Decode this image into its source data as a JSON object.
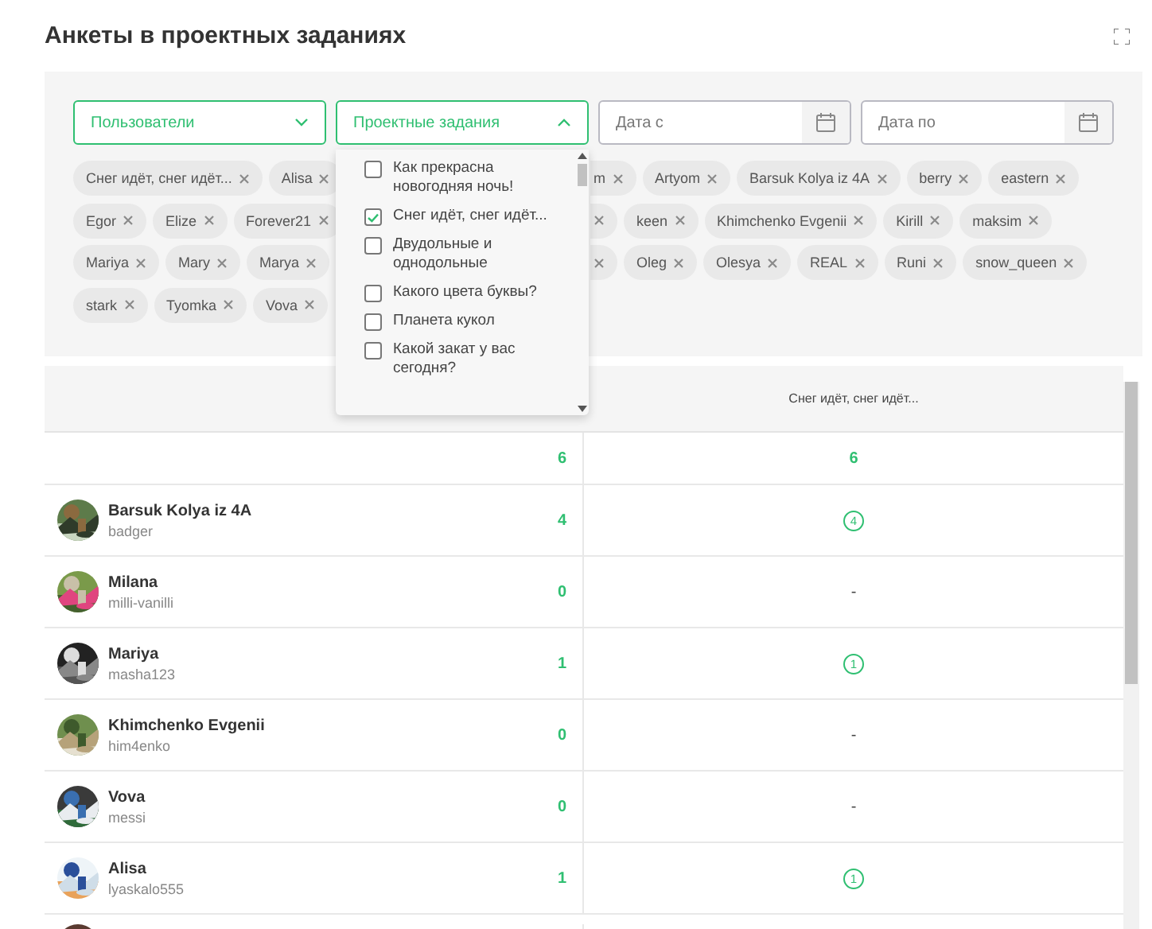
{
  "header": {
    "title": "Анкеты в проектных заданиях"
  },
  "filters": [
    {
      "kind": "select",
      "label": "Пользователи",
      "expanded": false
    },
    {
      "kind": "select",
      "label": "Проектные задания",
      "expanded": true
    },
    {
      "kind": "date",
      "placeholder": "Дата с"
    },
    {
      "kind": "date",
      "placeholder": "Дата по"
    }
  ],
  "tag_rows": [
    {
      "left": [
        {
          "label": "Снег идёт, снег идёт...",
          "clipped": false
        },
        {
          "label": "Alisa",
          "clipped": false
        }
      ],
      "right": [
        {
          "label": "m",
          "clipped": true
        },
        {
          "label": "Artyom",
          "clipped": false
        },
        {
          "label": "Barsuk Kolya iz 4A",
          "clipped": false
        },
        {
          "label": "berry",
          "clipped": false
        },
        {
          "label": "eastern",
          "clipped": false
        }
      ]
    },
    {
      "left": [
        {
          "label": "Egor",
          "clipped": false
        },
        {
          "label": "Elize",
          "clipped": false
        },
        {
          "label": "Forever21",
          "clipped": false
        }
      ],
      "right": [
        {
          "clipped": true
        },
        {
          "label": "keen",
          "clipped": false
        },
        {
          "label": "Khimchenko Evgenii",
          "clipped": false
        },
        {
          "label": "Kirill",
          "clipped": false
        },
        {
          "label": "maksim",
          "clipped": false
        }
      ]
    },
    {
      "left": [
        {
          "label": "Mariya",
          "clipped": false
        },
        {
          "label": "Mary",
          "clipped": false
        },
        {
          "label": "Marya",
          "clipped": false
        }
      ],
      "right": [
        {
          "clipped": true
        },
        {
          "label": "Oleg",
          "clipped": false
        },
        {
          "label": "Olesya",
          "clipped": false
        },
        {
          "label": "REAL",
          "clipped": false
        },
        {
          "label": "Runi",
          "clipped": false
        },
        {
          "label": "snow_queen",
          "clipped": false
        }
      ]
    },
    {
      "left": [
        {
          "label": "stark",
          "clipped": false
        },
        {
          "label": "Tyomka",
          "clipped": false
        },
        {
          "label": "Vova",
          "clipped": false
        }
      ],
      "right": []
    }
  ],
  "task_dropdown": {
    "items": [
      {
        "label": "Как прекрасна новогодняя ночь!",
        "checked": false
      },
      {
        "label": "Снег идёт, снег идёт...",
        "checked": true
      },
      {
        "label": "Двудольные и однодольные",
        "checked": false
      },
      {
        "label": "Какого цвета буквы?",
        "checked": false
      },
      {
        "label": "Планета кукол",
        "checked": false
      },
      {
        "label": "Какой закат у вас сегодня?",
        "checked": false
      }
    ]
  },
  "table": {
    "columns": [
      {
        "label": "Снег идёт, снег идёт..."
      }
    ],
    "total": {
      "count": "6",
      "values": [
        "6"
      ]
    },
    "rows": [
      {
        "kind": "user",
        "name": "Barsuk Kolya iz 4A",
        "login": "badger",
        "count": "4",
        "answers": [
          {
            "kind": "circle",
            "text": "4"
          }
        ]
      },
      {
        "kind": "user",
        "name": "Milana",
        "login": "milli-vanilli",
        "count": "0",
        "answers": [
          {
            "kind": "dash",
            "text": "-"
          }
        ]
      },
      {
        "kind": "user",
        "name": "Mariya",
        "login": "masha123",
        "count": "1",
        "answers": [
          {
            "kind": "circle",
            "text": "1"
          }
        ]
      },
      {
        "kind": "user",
        "name": "Khimchenko Evgenii",
        "login": "him4enko",
        "count": "0",
        "answers": [
          {
            "kind": "dash",
            "text": "-"
          }
        ]
      },
      {
        "kind": "user",
        "name": "Vova",
        "login": "messi",
        "count": "0",
        "answers": [
          {
            "kind": "dash",
            "text": "-"
          }
        ]
      },
      {
        "kind": "user",
        "name": "Alisa",
        "login": "lyaskalo555",
        "count": "1",
        "answers": [
          {
            "kind": "circle",
            "text": "1"
          }
        ]
      },
      {
        "kind": "cut"
      }
    ]
  }
}
